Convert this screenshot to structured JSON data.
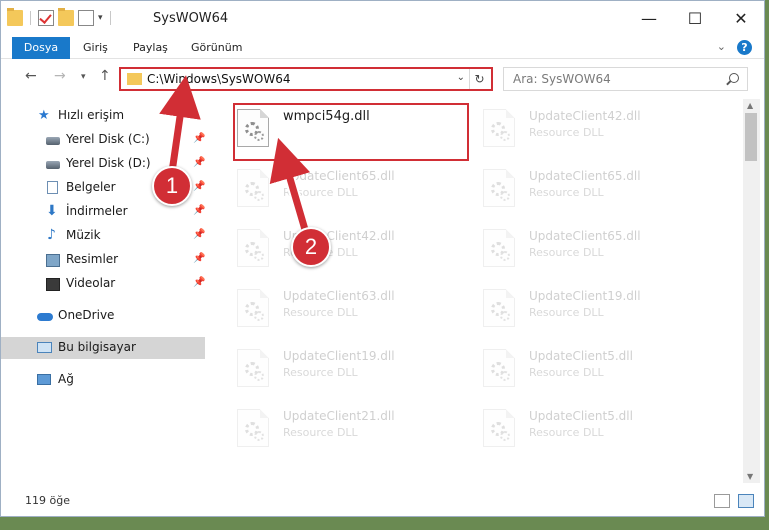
{
  "window": {
    "title": "SysWOW64",
    "controls": {
      "minimize": "—",
      "maximize": "☐",
      "close": "✕"
    }
  },
  "ribbon": {
    "tabs": [
      "Dosya",
      "Giriş",
      "Paylaş",
      "Görünüm"
    ],
    "expand_icon": "chevron-down",
    "help": "?"
  },
  "navigation": {
    "address": "C:\\Windows\\SysWOW64",
    "search_placeholder": "Ara: SysWOW64"
  },
  "sidebar": {
    "items": [
      {
        "label": "Hızlı erişim",
        "icon": "star-icon",
        "pinned": false
      },
      {
        "label": "Yerel Disk (C:)",
        "icon": "disk-icon",
        "pinned": true
      },
      {
        "label": "Yerel Disk (D:)",
        "icon": "disk-icon",
        "pinned": true
      },
      {
        "label": "Belgeler",
        "icon": "document-icon",
        "pinned": true
      },
      {
        "label": "İndirmeler",
        "icon": "download-icon",
        "pinned": true
      },
      {
        "label": "Müzik",
        "icon": "music-icon",
        "pinned": true
      },
      {
        "label": "Resimler",
        "icon": "pictures-icon",
        "pinned": true
      },
      {
        "label": "Videolar",
        "icon": "video-icon",
        "pinned": true
      },
      {
        "label": "OneDrive",
        "icon": "cloud-icon",
        "pinned": false
      },
      {
        "label": "Bu bilgisayar",
        "icon": "computer-icon",
        "pinned": false,
        "selected": true
      },
      {
        "label": "Ağ",
        "icon": "network-icon",
        "pinned": false
      }
    ]
  },
  "files": {
    "highlighted": {
      "name": "wmpci54g.dll"
    },
    "left_column": [
      {
        "name": "UpdateClient65.dll",
        "type": "Resource DLL"
      },
      {
        "name": "UpdateClient42.dll",
        "type": "Resource DLL"
      },
      {
        "name": "UpdateClient63.dll",
        "type": "Resource DLL"
      },
      {
        "name": "UpdateClient19.dll",
        "type": "Resource DLL"
      },
      {
        "name": "UpdateClient21.dll",
        "type": "Resource DLL"
      }
    ],
    "right_column": [
      {
        "name": "UpdateClient42.dll",
        "type": "Resource DLL"
      },
      {
        "name": "UpdateClient65.dll",
        "type": "Resource DLL"
      },
      {
        "name": "UpdateClient65.dll",
        "type": "Resource DLL"
      },
      {
        "name": "UpdateClient19.dll",
        "type": "Resource DLL"
      },
      {
        "name": "UpdateClient5.dll",
        "type": "Resource DLL"
      },
      {
        "name": "UpdateClient5.dll",
        "type": "Resource DLL"
      }
    ]
  },
  "status": {
    "count": "119 öğe"
  },
  "annotations": {
    "step1": "1",
    "step2": "2",
    "color": "#d12e35"
  }
}
